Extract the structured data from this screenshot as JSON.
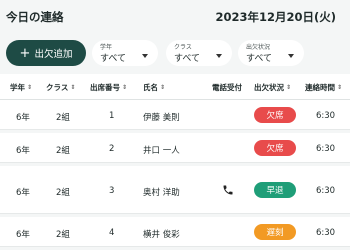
{
  "header": {
    "title": "今日の連絡",
    "date": "2023年12月20日(火)"
  },
  "toolbar": {
    "add_label": "出欠追加"
  },
  "filters": [
    {
      "label": "学年",
      "value": "すべて"
    },
    {
      "label": "クラス",
      "value": "すべて"
    },
    {
      "label": "出欠状況",
      "value": "すべて"
    }
  ],
  "table": {
    "columns": [
      "学年",
      "クラス",
      "出席番号",
      "氏名",
      "電話受付",
      "出欠状況",
      "連絡時間"
    ],
    "rows": [
      {
        "grade": "6年",
        "class": "2組",
        "number": "1",
        "name": "伊藤 美則",
        "phone": false,
        "status": "欠席",
        "status_color": "#e84b4b",
        "time": "6:30"
      },
      {
        "grade": "6年",
        "class": "2組",
        "number": "2",
        "name": "井口 一人",
        "phone": false,
        "status": "欠席",
        "status_color": "#e84b4b",
        "time": "6:30"
      },
      {
        "grade": "6年",
        "class": "2組",
        "number": "3",
        "name": "奥村 洋助",
        "phone": true,
        "status": "早退",
        "status_color": "#1f9e78",
        "time": "6:30"
      },
      {
        "grade": "6年",
        "class": "2組",
        "number": "4",
        "name": "横井 俊彩",
        "phone": false,
        "status": "遅刻",
        "status_color": "#f29a24",
        "time": "6:30"
      }
    ]
  },
  "colors": {
    "primary": "#1e4b45",
    "absent": "#e84b4b",
    "early": "#1f9e78",
    "late": "#f29a24"
  }
}
